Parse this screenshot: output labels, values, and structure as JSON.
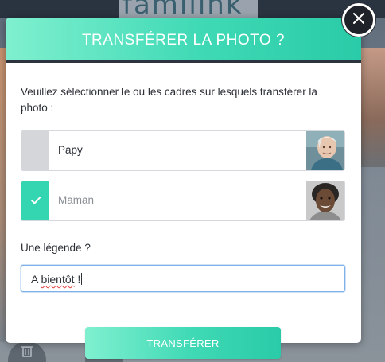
{
  "background": {
    "logo_text": "familink"
  },
  "modal": {
    "title": "TRANSFÉRER LA PHOTO ?",
    "instruction": "Veuillez sélectionner le ou les cadres sur lesquels transférer la photo :",
    "frames": [
      {
        "name": "Papy",
        "selected": false,
        "photo": "elderly-man-portrait"
      },
      {
        "name": "Maman",
        "selected": true,
        "photo": "woman-portrait"
      }
    ],
    "caption": {
      "label": "Une légende ?",
      "value_prefix": "A ",
      "value_misspelled": "bientôt",
      "value_suffix": " !"
    },
    "submit_label": "TRANSFÉRER"
  },
  "colors": {
    "accent": "#33d6b0",
    "accent_light": "#7ff0cf",
    "header_border": "#2d3440",
    "input_focus": "#7fb2e8",
    "unchecked": "#d4d6d9",
    "spellcheck": "#e23b3b"
  },
  "icons": {
    "close": "close-x-icon",
    "check": "checkmark-icon",
    "trash": "trash-icon"
  }
}
